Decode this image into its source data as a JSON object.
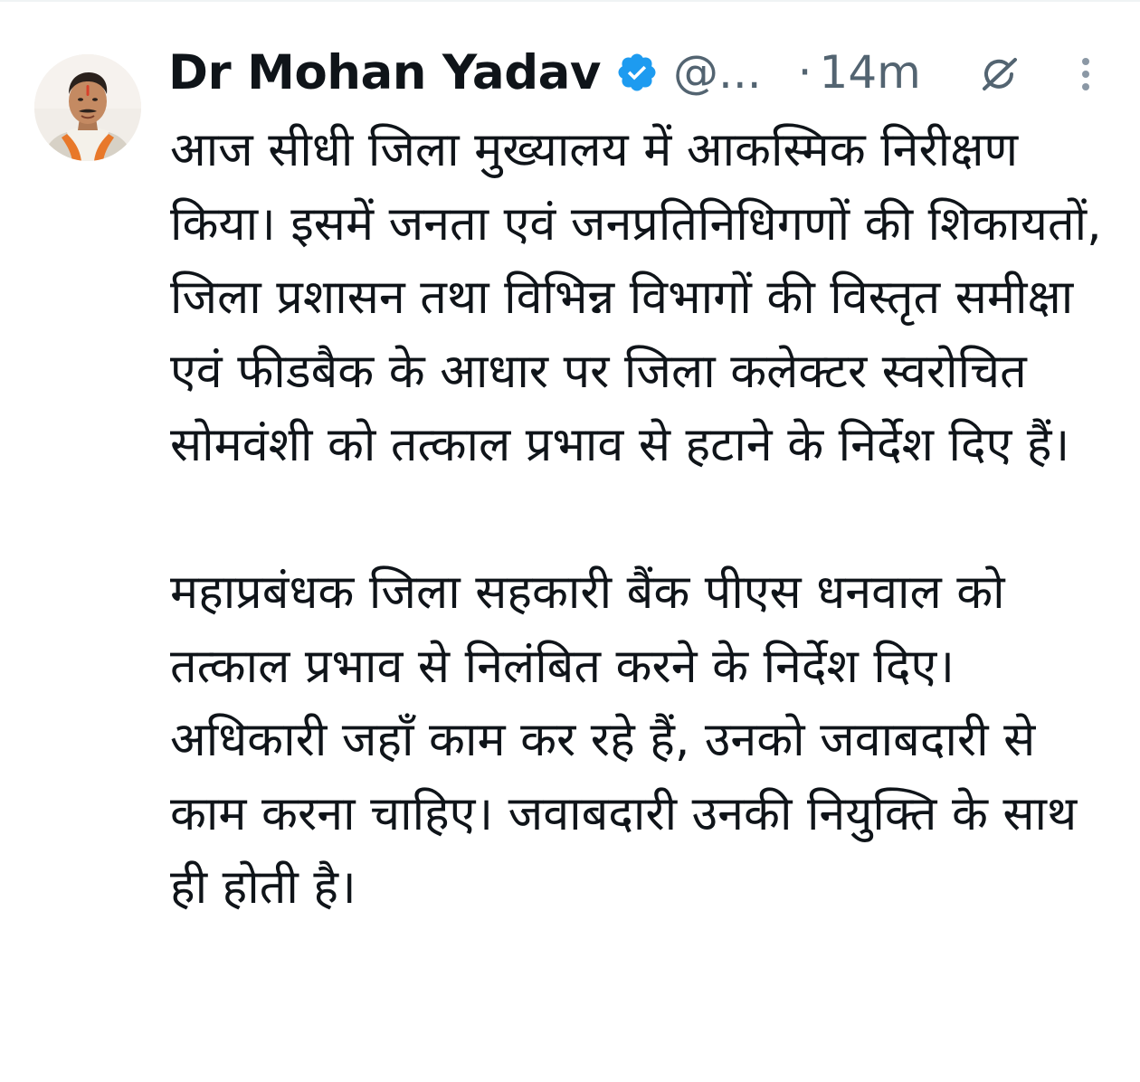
{
  "post": {
    "author": {
      "display_name": "Dr Mohan Yadav",
      "handle": "@...",
      "verified": true,
      "avatar_icon": "profile-photo"
    },
    "separator": "·",
    "time": "14m",
    "icons": {
      "verified": "verified-badge-icon",
      "grok": "grok-icon",
      "more": "more-options-icon"
    },
    "paragraphs": [
      "आज सीधी जिला मुख्यालय में आकस्मिक निरीक्षण किया। इसमें जनता एवं जनप्रतिनिधिगणों की शिकायतों, जिला प्रशासन तथा विभिन्न विभागों की विस्तृत समीक्षा एवं फीडबैक के आधार पर जिला कलेक्टर स्वरोचित सोमवंशी को तत्काल प्रभाव से हटाने के निर्देश दिए हैं।",
      "महाप्रबंधक जिला सहकारी बैंक पीएस धनवाल को तत्काल प्रभाव से निलंबित करने के निर्देश दिए। अधिकारी जहाँ काम कर रहे हैं, उनको जवाबदारी से काम करना चाहिए। जवाबदारी उनकी नियुक्ति के साथ ही होती है।"
    ]
  },
  "colors": {
    "text_primary": "#0f1419",
    "text_secondary": "#536471",
    "verified_blue": "#1d9bf0",
    "background": "#ffffff"
  }
}
